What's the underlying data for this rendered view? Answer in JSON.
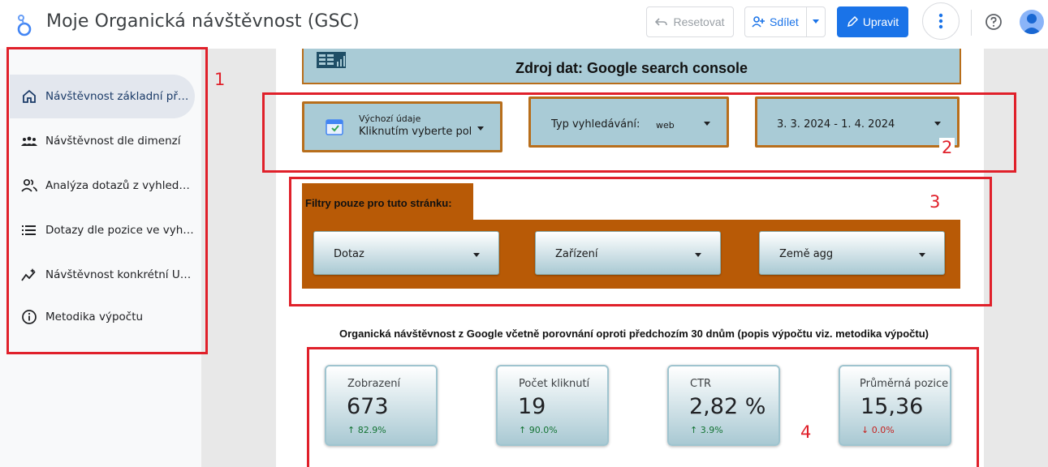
{
  "topbar": {
    "title": "Moje Organická návštěvnost (GSC)",
    "reset_label": "Resetovat",
    "share_label": "Sdílet",
    "edit_label": "Upravit"
  },
  "sidebar": {
    "items": [
      {
        "label": "Návštěvnost základní př…",
        "icon": "home-icon"
      },
      {
        "label": "Návštěvnost dle dimenzí",
        "icon": "group-icon"
      },
      {
        "label": "Analýza dotazů z vyhled…",
        "icon": "people-icon"
      },
      {
        "label": "Dotazy dle pozice ve vyh…",
        "icon": "list-icon"
      },
      {
        "label": "Návštěvnost konkrétní U…",
        "icon": "sparkline-icon"
      },
      {
        "label": "Metodika výpočtu",
        "icon": "info-icon"
      }
    ]
  },
  "report": {
    "header_subtitle": "Zdroj dat: Google search console",
    "controls": {
      "data_source_label": "Výchozí údaje",
      "data_source_value": "Kliknutím vyberte pol",
      "search_type_label": "Typ vyhledávání:",
      "search_type_value": "web",
      "date_range": "3. 3. 2024 - 1. 4. 2024"
    },
    "filters": {
      "title": "Filtry pouze pro tuto stránku:",
      "dropdowns": [
        "Dotaz",
        "Zařízení",
        "Země agg"
      ]
    },
    "kpi_section_title": "Organická návštěvnost z Google včetně porovnání oproti předchozím 30 dnům (popis výpočtu viz. metodika výpočtu)",
    "kpis": [
      {
        "name": "Zobrazení",
        "value": "673",
        "delta": "82.9%",
        "direction": "up"
      },
      {
        "name": "Počet kliknutí",
        "value": "19",
        "delta": "90.0%",
        "direction": "up"
      },
      {
        "name": "CTR",
        "value": "2,82 %",
        "delta": "3.9%",
        "direction": "up"
      },
      {
        "name": "Průměrná pozice",
        "value": "15,36",
        "delta": "0.0%",
        "direction": "down"
      }
    ]
  },
  "annotations": [
    "1",
    "2",
    "3",
    "4"
  ],
  "colors": {
    "accent": "#1a73e8",
    "annotation": "#e0202a",
    "control_fill": "#a9cbd6",
    "control_border": "#b86e1b",
    "filter_panel": "#b85a06",
    "delta_up": "#137333",
    "delta_down": "#c5221f"
  }
}
